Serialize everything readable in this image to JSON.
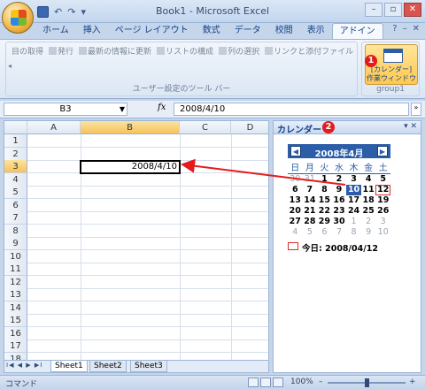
{
  "window": {
    "title": "Book1 - Microsoft Excel",
    "min": "–",
    "max": "▫",
    "close": "✕"
  },
  "qat": {
    "undo": "↶",
    "redo": "↷",
    "more": "▾"
  },
  "tabs": [
    "ホーム",
    "挿入",
    "ページ レイアウト",
    "数式",
    "データ",
    "校閲",
    "表示",
    "アドイン"
  ],
  "help": {
    "question": "?",
    "min": "–",
    "close": "✕"
  },
  "ribbon": {
    "items": [
      "目の取得",
      "発行",
      "最新の情報に更新",
      "リストの構成",
      "列の選択",
      "リンクと添付ファイル"
    ],
    "group_label": "ユーザー設定のツール バー",
    "calendar_button": "[カレンダー]\n作業ウィンドウ",
    "calendar_line1": "[カレンダー]",
    "calendar_line2": "作業ウィンドウ",
    "group1_label": "group1",
    "badge1": "❶"
  },
  "formula_bar": {
    "namebox": "B3",
    "fx": "fx",
    "value": "2008/4/10"
  },
  "sheet": {
    "columns": [
      "A",
      "B",
      "C",
      "D"
    ],
    "rows": [
      "1",
      "2",
      "3",
      "4",
      "5",
      "6",
      "7",
      "8",
      "9",
      "10",
      "11",
      "12",
      "13",
      "14",
      "15",
      "16",
      "17",
      "18"
    ],
    "active_cell": "B3",
    "b3_value": "2008/4/10"
  },
  "sheet_tabs": {
    "nav": "I◀ ◀ ▶ ▶I",
    "tabs": [
      "Sheet1",
      "Sheet2",
      "Sheet3"
    ]
  },
  "status": {
    "mode": "コマンド",
    "zoom": "100%",
    "minus": "–",
    "plus": "+"
  },
  "pane": {
    "title": "カレンダー",
    "badge2": "❷",
    "controls": "▾ ✕",
    "month": "2008年4月",
    "prev": "◀",
    "next": "▶",
    "dow": [
      "日",
      "月",
      "火",
      "水",
      "木",
      "金",
      "土"
    ],
    "days": [
      "30",
      "31",
      "1",
      "2",
      "3",
      "4",
      "5",
      "6",
      "7",
      "8",
      "9",
      "10",
      "11",
      "12",
      "13",
      "14",
      "15",
      "16",
      "17",
      "18",
      "19",
      "20",
      "21",
      "22",
      "23",
      "24",
      "25",
      "26",
      "27",
      "28",
      "29",
      "30",
      "1",
      "2",
      "3",
      "4",
      "5",
      "6",
      "7",
      "8",
      "9",
      "10"
    ],
    "today": "今日: 2008/04/12"
  },
  "colors": {
    "accent": "#2c5ea8",
    "arrow": "#e31b1b"
  }
}
